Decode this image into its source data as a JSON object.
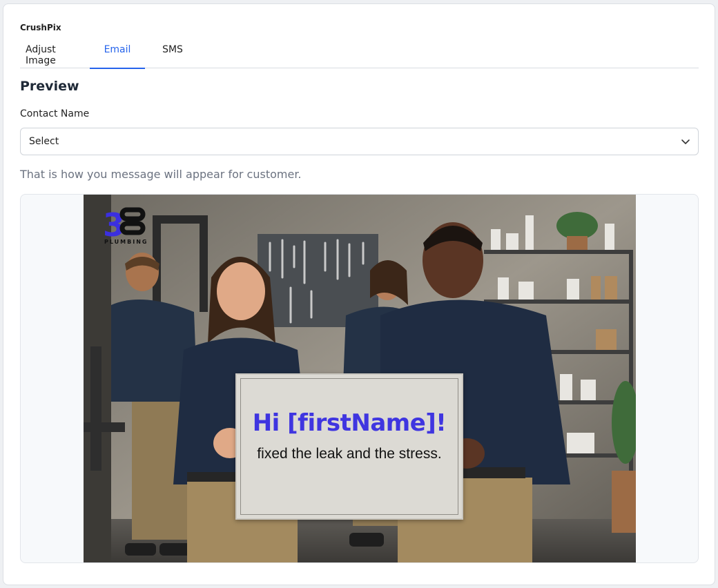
{
  "app": {
    "title": "CrushPix"
  },
  "tabs": [
    {
      "label": "Adjust Image",
      "active": false
    },
    {
      "label": "Email",
      "active": true
    },
    {
      "label": "SMS",
      "active": false
    }
  ],
  "preview": {
    "heading": "Preview",
    "contact_label": "Contact Name",
    "contact_select_value": "Select",
    "helper_text": "That is how you message will appear for customer."
  },
  "image": {
    "logo_mark": "3S",
    "logo_subtext": "PLUMBING",
    "sign_greeting": "Hi [firstName]!",
    "sign_message": "fixed the leak and the stress."
  },
  "colors": {
    "accent": "#2563eb",
    "sign_text": "#3f35e0",
    "logo_blue": "#3b2fe0"
  },
  "icons": {
    "select_chevron": "chevron-down-icon"
  }
}
